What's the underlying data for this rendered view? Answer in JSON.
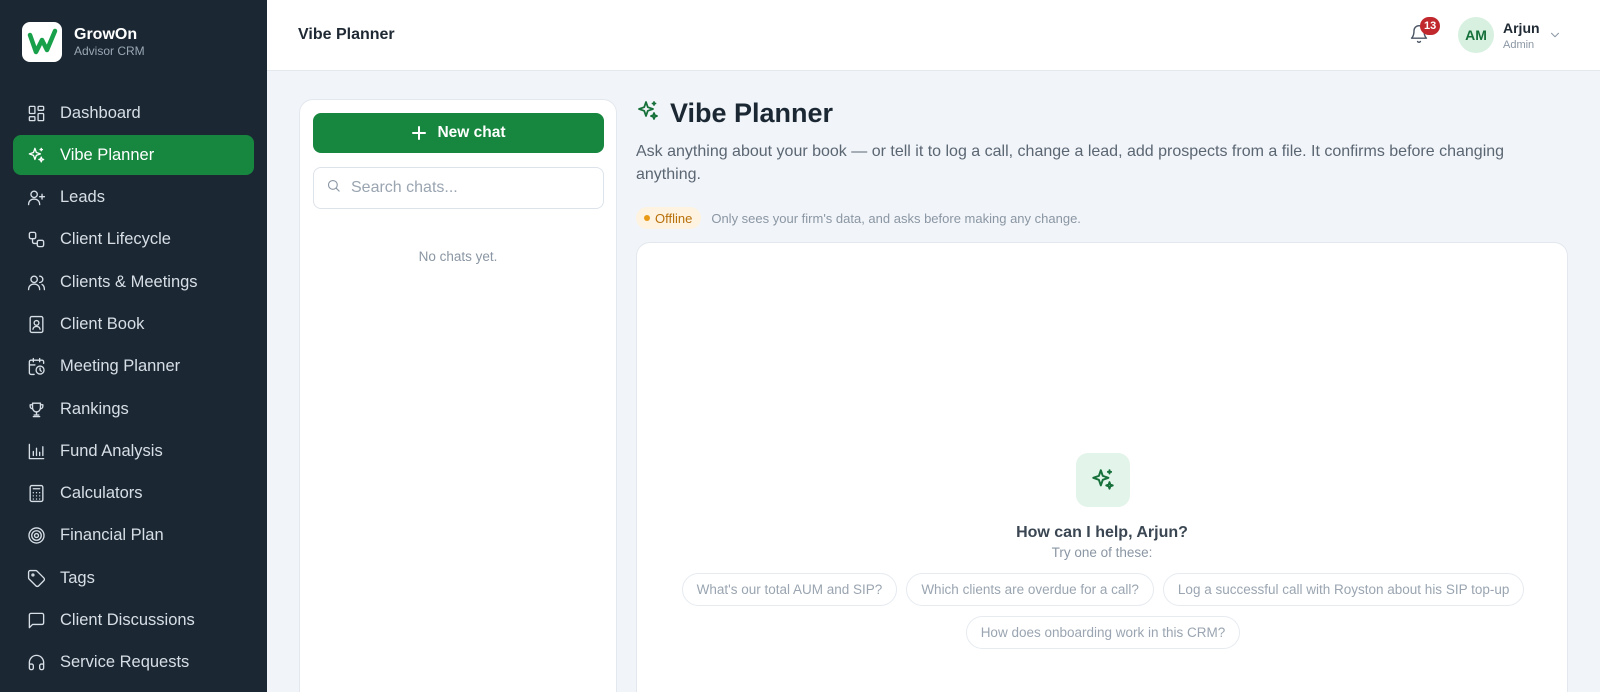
{
  "brand": {
    "name": "GrowOn",
    "subtitle": "Advisor CRM"
  },
  "sidebar": {
    "items": [
      {
        "label": "Dashboard",
        "icon": "dashboard-icon",
        "active": false
      },
      {
        "label": "Vibe Planner",
        "icon": "sparkles-icon",
        "active": true
      },
      {
        "label": "Leads",
        "icon": "user-plus-icon",
        "active": false
      },
      {
        "label": "Client Lifecycle",
        "icon": "workflow-icon",
        "active": false
      },
      {
        "label": "Clients & Meetings",
        "icon": "users-icon",
        "active": false
      },
      {
        "label": "Client Book",
        "icon": "contact-book-icon",
        "active": false
      },
      {
        "label": "Meeting Planner",
        "icon": "calendar-clock-icon",
        "active": false
      },
      {
        "label": "Rankings",
        "icon": "trophy-icon",
        "active": false
      },
      {
        "label": "Fund Analysis",
        "icon": "bar-chart-icon",
        "active": false
      },
      {
        "label": "Calculators",
        "icon": "calculator-icon",
        "active": false
      },
      {
        "label": "Financial Plan",
        "icon": "target-icon",
        "active": false
      },
      {
        "label": "Tags",
        "icon": "tag-icon",
        "active": false
      },
      {
        "label": "Client Discussions",
        "icon": "message-square-icon",
        "active": false
      },
      {
        "label": "Service Requests",
        "icon": "headphones-icon",
        "active": false
      }
    ]
  },
  "header": {
    "title": "Vibe Planner",
    "notification_count": "13",
    "user": {
      "initials": "AM",
      "name": "Arjun",
      "role": "Admin"
    }
  },
  "chat_list": {
    "new_chat_label": "New chat",
    "search_placeholder": "Search chats...",
    "empty_text": "No chats yet."
  },
  "main": {
    "title": "Vibe Planner",
    "description": "Ask anything about your book — or tell it to log a call, change a lead, add prospects from a file. It confirms before changing anything.",
    "status_label": "Offline",
    "status_text": "Only sees your firm's data, and asks before making any change.",
    "hero_title": "How can I help, Arjun?",
    "hero_subtitle": "Try one of these:",
    "suggestions": [
      "What's our total AUM and SIP?",
      "Which clients are overdue for a call?",
      "Log a successful call with Royston about his SIP top-up",
      "How does onboarding work in this CRM?"
    ]
  },
  "colors": {
    "sidebar_bg": "#1b2834",
    "accent_green": "#17873f",
    "badge_red": "#c0282d",
    "offline_amber": "#b8700a"
  }
}
